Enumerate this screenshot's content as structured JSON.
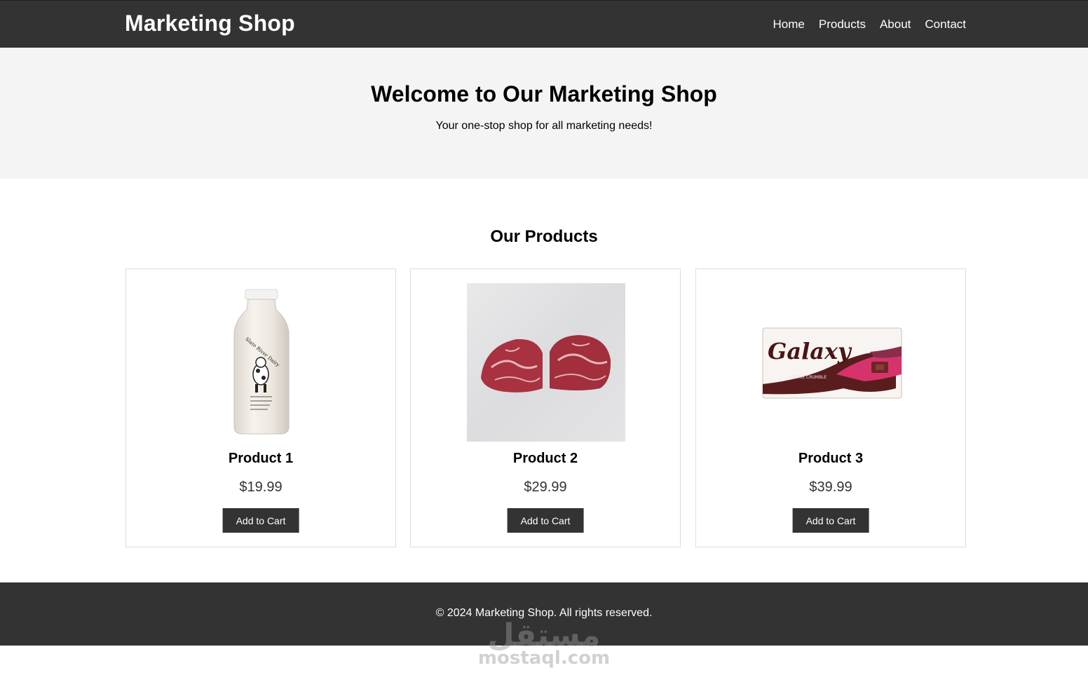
{
  "header": {
    "logo": "Marketing Shop",
    "nav": [
      "Home",
      "Products",
      "About",
      "Contact"
    ]
  },
  "hero": {
    "title": "Welcome to Our Marketing Shop",
    "subtitle": "Your one-stop shop for all marketing needs!"
  },
  "products": {
    "title": "Our Products",
    "items": [
      {
        "name": "Product 1",
        "price": "$19.99",
        "button": "Add to Cart",
        "image": "milk-bottle-image"
      },
      {
        "name": "Product 2",
        "price": "$29.99",
        "button": "Add to Cart",
        "image": "beef-cuts-image"
      },
      {
        "name": "Product 3",
        "price": "$39.99",
        "button": "Add to Cart",
        "image": "galaxy-chocolate-image"
      }
    ]
  },
  "footer": {
    "text": "© 2024 Marketing Shop. All rights reserved."
  },
  "watermark": {
    "arabic": "مستقل",
    "latin": "mostaql.com"
  },
  "images": {
    "milk_label": "Slate River Dairy",
    "chocolate_brand": "Galaxy",
    "chocolate_variant": "COOKIE CRUMBLE"
  },
  "colors": {
    "header_bg": "#333333",
    "hero_bg": "#f4f4f4",
    "button_bg": "#333333",
    "card_border": "#dddddd"
  }
}
